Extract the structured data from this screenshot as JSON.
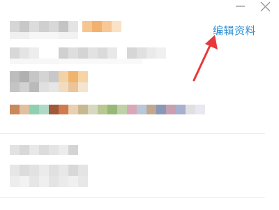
{
  "window": {
    "minimize_icon": "minimize-icon",
    "close_icon": "close-icon"
  },
  "profile": {
    "edit_label": "编辑资料",
    "arrow_color": "#e8383a",
    "link_color": "#2a8fd6"
  },
  "swatches": [
    "#c88a5a",
    "#e0c0a0",
    "#8fd0b0",
    "#b0d8c8",
    "#a05a3a",
    "#d07a50",
    "#e8d0b0",
    "#c8b890",
    "#d8d8c0",
    "#b8c890",
    "#98b878",
    "#c0d0a8",
    "#d8a8b8",
    "#b8c8d8",
    "#c0a890",
    "#8898b8",
    "#c8a0b0",
    "#a8b0d0",
    "#e0e0e0",
    "#e8e8f0"
  ]
}
